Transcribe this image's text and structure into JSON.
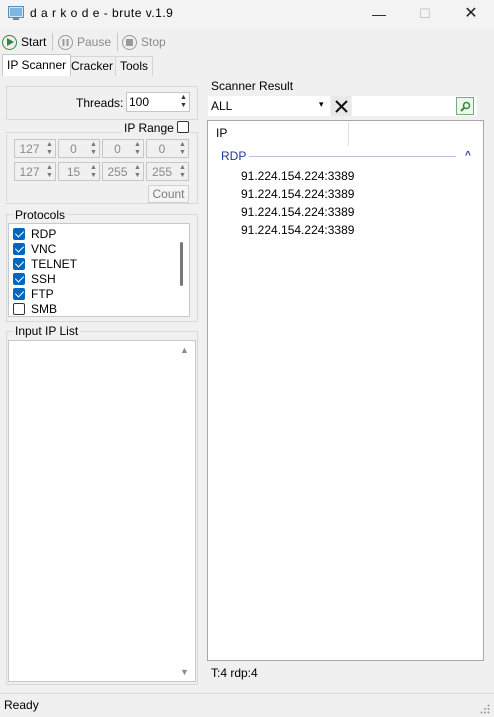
{
  "window": {
    "title": "d a r k o d e - brute v.1.9",
    "minimize": "—",
    "maximize": "☐",
    "close": "✕"
  },
  "toolbar": {
    "start": "Start",
    "pause": "Pause",
    "stop": "Stop"
  },
  "tabs": [
    "IP Scanner",
    "Cracker",
    "Tools"
  ],
  "threads": {
    "label": "Threads:",
    "value": "100"
  },
  "ip_range": {
    "label": "IP Range",
    "checked": false,
    "start": [
      "127",
      "0",
      "0",
      "0"
    ],
    "end": [
      "127",
      "15",
      "255",
      "255"
    ],
    "count_button": "Count"
  },
  "protocols": {
    "label": "Protocols",
    "items": [
      {
        "name": "RDP",
        "checked": true
      },
      {
        "name": "VNC",
        "checked": true
      },
      {
        "name": "TELNET",
        "checked": true
      },
      {
        "name": "SSH",
        "checked": true
      },
      {
        "name": "FTP",
        "checked": true
      },
      {
        "name": "SMB",
        "checked": false
      }
    ]
  },
  "input_ip_list": {
    "label": "Input IP List"
  },
  "scanner_result": {
    "label": "Scanner Result",
    "filter_value": "ALL",
    "column_header": "IP",
    "group_name": "RDP",
    "rows": [
      "91.224.154.224:3389",
      "91.224.154.224:3389",
      "91.224.154.224:3389",
      "91.224.154.224:3389"
    ],
    "summary": "T:4 rdp:4"
  },
  "status": {
    "text": "Ready"
  },
  "colors": {
    "accent": "#0067c0",
    "group_header": "#1f3a93",
    "start_green": "#2e8b3a"
  }
}
